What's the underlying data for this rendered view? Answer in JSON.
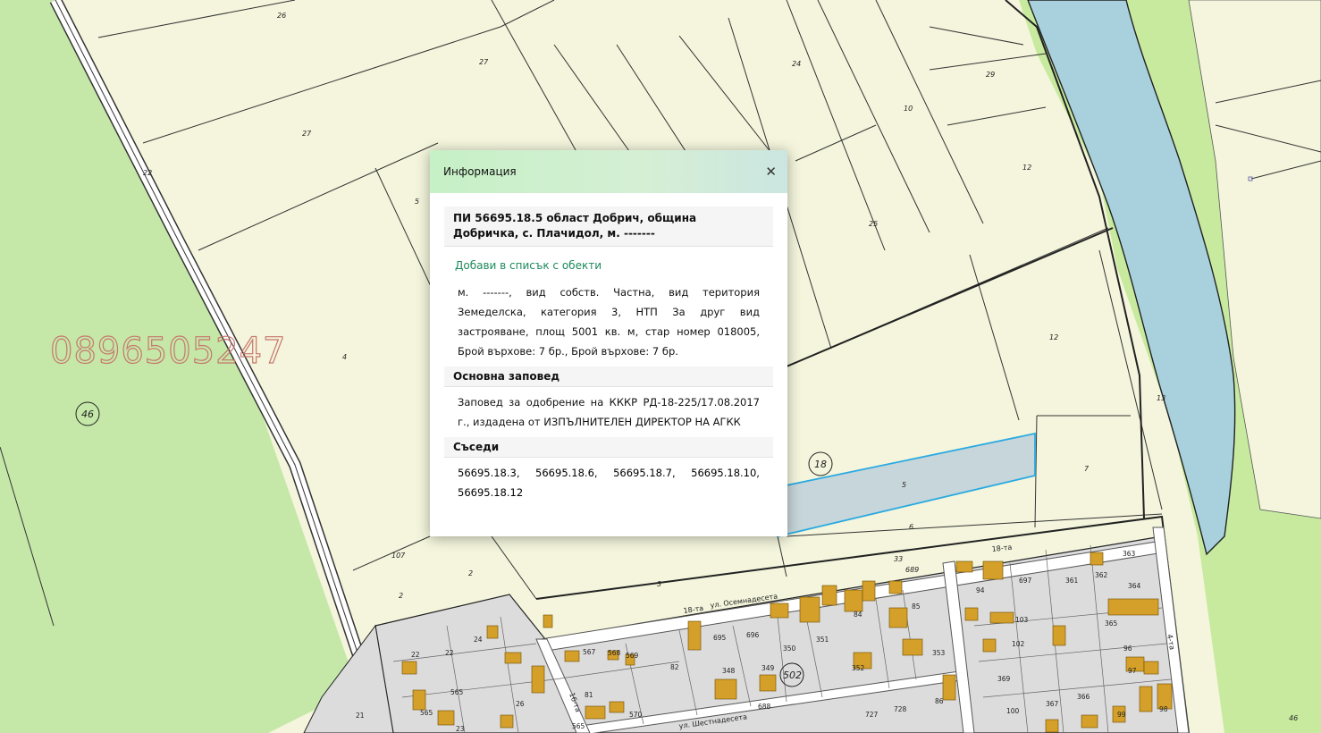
{
  "map": {
    "parcel_numbers": [
      "26",
      "27",
      "27",
      "5",
      "4",
      "22",
      "24",
      "29",
      "10",
      "12",
      "25",
      "12",
      "13",
      "7",
      "5",
      "6",
      "3",
      "2",
      "2",
      "107",
      "33",
      "689",
      "18-та",
      "18-та",
      "4-та",
      "Осемнадесета",
      "Шестнадесета",
      "16-та",
      "363",
      "362",
      "364",
      "361",
      "697",
      "94",
      "103",
      "365",
      "102",
      "96",
      "97",
      "369",
      "367",
      "366",
      "99",
      "98",
      "695",
      "696",
      "350",
      "351",
      "352",
      "353",
      "84",
      "85",
      "86",
      "728",
      "727",
      "348",
      "349",
      "688",
      "567",
      "568",
      "569",
      "81",
      "82",
      "570",
      "565",
      "566",
      "24",
      "22",
      "22",
      "21",
      "23",
      "26",
      "46"
    ],
    "circled_numbers": [
      "46",
      "18",
      "502"
    ],
    "watermark_phone": "0896505247",
    "colors": {
      "field": "#f4f5dc",
      "green_area": "#c5e8a8",
      "river": "#a8d1dd",
      "urban": "#dcdcdc",
      "building": "#d4a02a",
      "selected_parcel": "#c7d6da",
      "selected_outline": "#2aaae2"
    }
  },
  "popup": {
    "title": "Информация",
    "close_icon": "close-icon",
    "parcel_title": "ПИ 56695.18.5 област Добрич, община Добричка, с. Плачидол, м. -------",
    "add_link": "Добави в списък с обекти",
    "description": "м. -------, вид собств. Частна, вид територия Земеделска, категория 3, НТП За друг вид застрояване, площ 5001 кв. м, стар номер 018005, Брой върхове: 7 бр., Брой върхове: 7 бр.",
    "order_heading": "Основна заповед",
    "order_text": "Заповед за одобрение на КККР РД-18-225/17.08.2017 г., издадена от ИЗПЪЛНИТЕЛЕН ДИРЕКТОР НА АГКК",
    "neighbors_heading": "Съседи",
    "neighbors": [
      "56695.18.3,",
      "56695.18.6,",
      "56695.18.7,",
      "56695.18.10,",
      "56695.18.12"
    ]
  }
}
